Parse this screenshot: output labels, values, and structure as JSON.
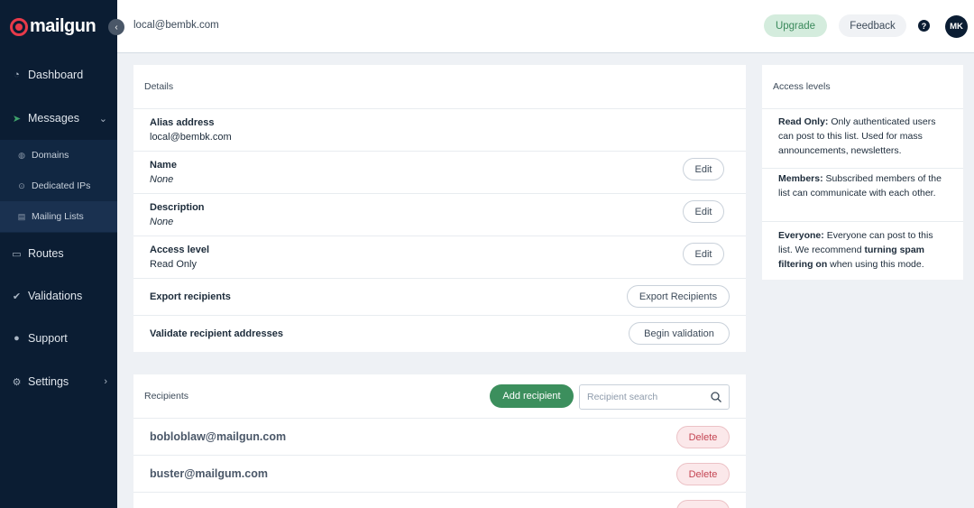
{
  "brand": {
    "name": "mailgun",
    "accent": "#e83a4a"
  },
  "sidebar": {
    "items": [
      {
        "label": "Dashboard",
        "icon": "dashboard-icon"
      },
      {
        "label": "Messages",
        "icon": "send-icon"
      },
      {
        "label": "Routes",
        "icon": "routes-icon"
      },
      {
        "label": "Validations",
        "icon": "validations-icon"
      },
      {
        "label": "Support",
        "icon": "support-icon"
      },
      {
        "label": "Settings",
        "icon": "gear-icon"
      }
    ],
    "sub_items": [
      {
        "label": "Domains",
        "icon": "globe-icon"
      },
      {
        "label": "Dedicated IPs",
        "icon": "pin-icon"
      },
      {
        "label": "Mailing Lists",
        "icon": "list-icon"
      }
    ]
  },
  "topbar": {
    "breadcrumb": "local@bembk.com",
    "upgrade_label": "Upgrade",
    "feedback_label": "Feedback",
    "help_label": "?",
    "avatar_initials": "MK"
  },
  "details": {
    "header": "Details",
    "alias_label": "Alias address",
    "alias_value": "local@bembk.com",
    "name_label": "Name",
    "name_value": "None",
    "description_label": "Description",
    "description_value": "None",
    "access_label": "Access level",
    "access_value": "Read Only",
    "edit_label": "Edit",
    "export_label": "Export recipients",
    "export_button": "Export Recipients",
    "validate_label": "Validate recipient addresses",
    "validate_button": "Begin validation"
  },
  "recipients": {
    "header": "Recipients",
    "add_label": "Add recipient",
    "search_placeholder": "Recipient search",
    "delete_label": "Delete",
    "items": [
      {
        "email": "bobloblaw@mailgun.com"
      },
      {
        "email": "buster@mailgum.com"
      }
    ]
  },
  "access_levels": {
    "header": "Access levels",
    "read_only_title": "Read Only:",
    "read_only_text": " Only authenticated users can post to this list. Used for mass announcements, newsletters.",
    "members_title": "Members:",
    "members_text": " Subscribed members of the list can communicate with each other.",
    "everyone_title": "Everyone:",
    "everyone_text_1": " Everyone can post to this list. We recommend ",
    "everyone_bold": "turning spam filtering on",
    "everyone_text_2": " when using this mode."
  }
}
